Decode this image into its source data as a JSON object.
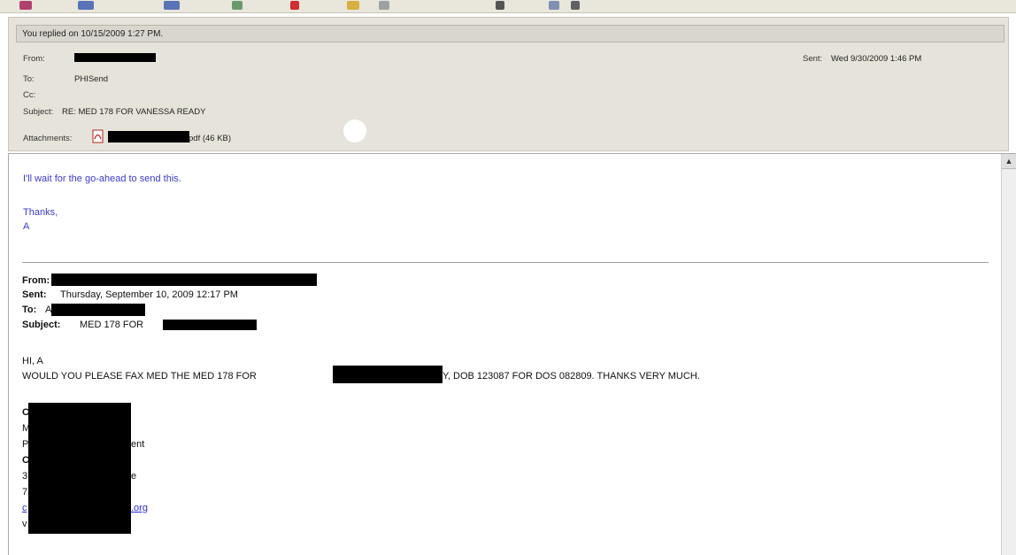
{
  "header": {
    "reply_notice": "You replied on 10/15/2009 1:27 PM.",
    "from_label": "From:",
    "to_label": "To:",
    "to_value": "PHISend",
    "cc_label": "Cc:",
    "subject_label": "Subject:",
    "subject_value": "RE: MED 178 FOR VANESSA READY",
    "sent_label": "Sent:",
    "sent_value": "Wed 9/30/2009 1:46 PM",
    "attachments_label": "Attachments:",
    "attachment_suffix": "pdf (46 KB)"
  },
  "body": {
    "reply_line1": "I'll wait for the go-ahead to send this.",
    "reply_thanks": "Thanks,",
    "reply_sign": "A",
    "forwarded": {
      "from_label": "From:",
      "sent_label": "Sent:",
      "sent_value": "Thursday, September 10, 2009 12:17 PM",
      "to_label": "To:",
      "to_value": "A",
      "subject_label": "Subject:",
      "subject_value": "MED 178 FOR"
    },
    "greeting": "HI, A",
    "message_prefix": "WOULD YOU PLEASE FAX MED THE MED 178 FOR",
    "message_suffix": "Y, DOB 123087 FOR DOS 082809. THANKS VERY MUCH.",
    "sig_line1": "C",
    "sig_line2": "M",
    "sig_line3_prefix": "P",
    "sig_line3_suffix": "ent",
    "sig_line4": "C",
    "sig_line5_prefix": "3",
    "sig_line5_suffix": "e",
    "sig_line6": "7",
    "sig_email_prefix": "c",
    "sig_email_suffix": ".org",
    "sig_line8": "v"
  },
  "colors": {
    "reply_text": "#3a3ad0",
    "header_bg": "#e6e3da",
    "redaction": "#000000"
  }
}
